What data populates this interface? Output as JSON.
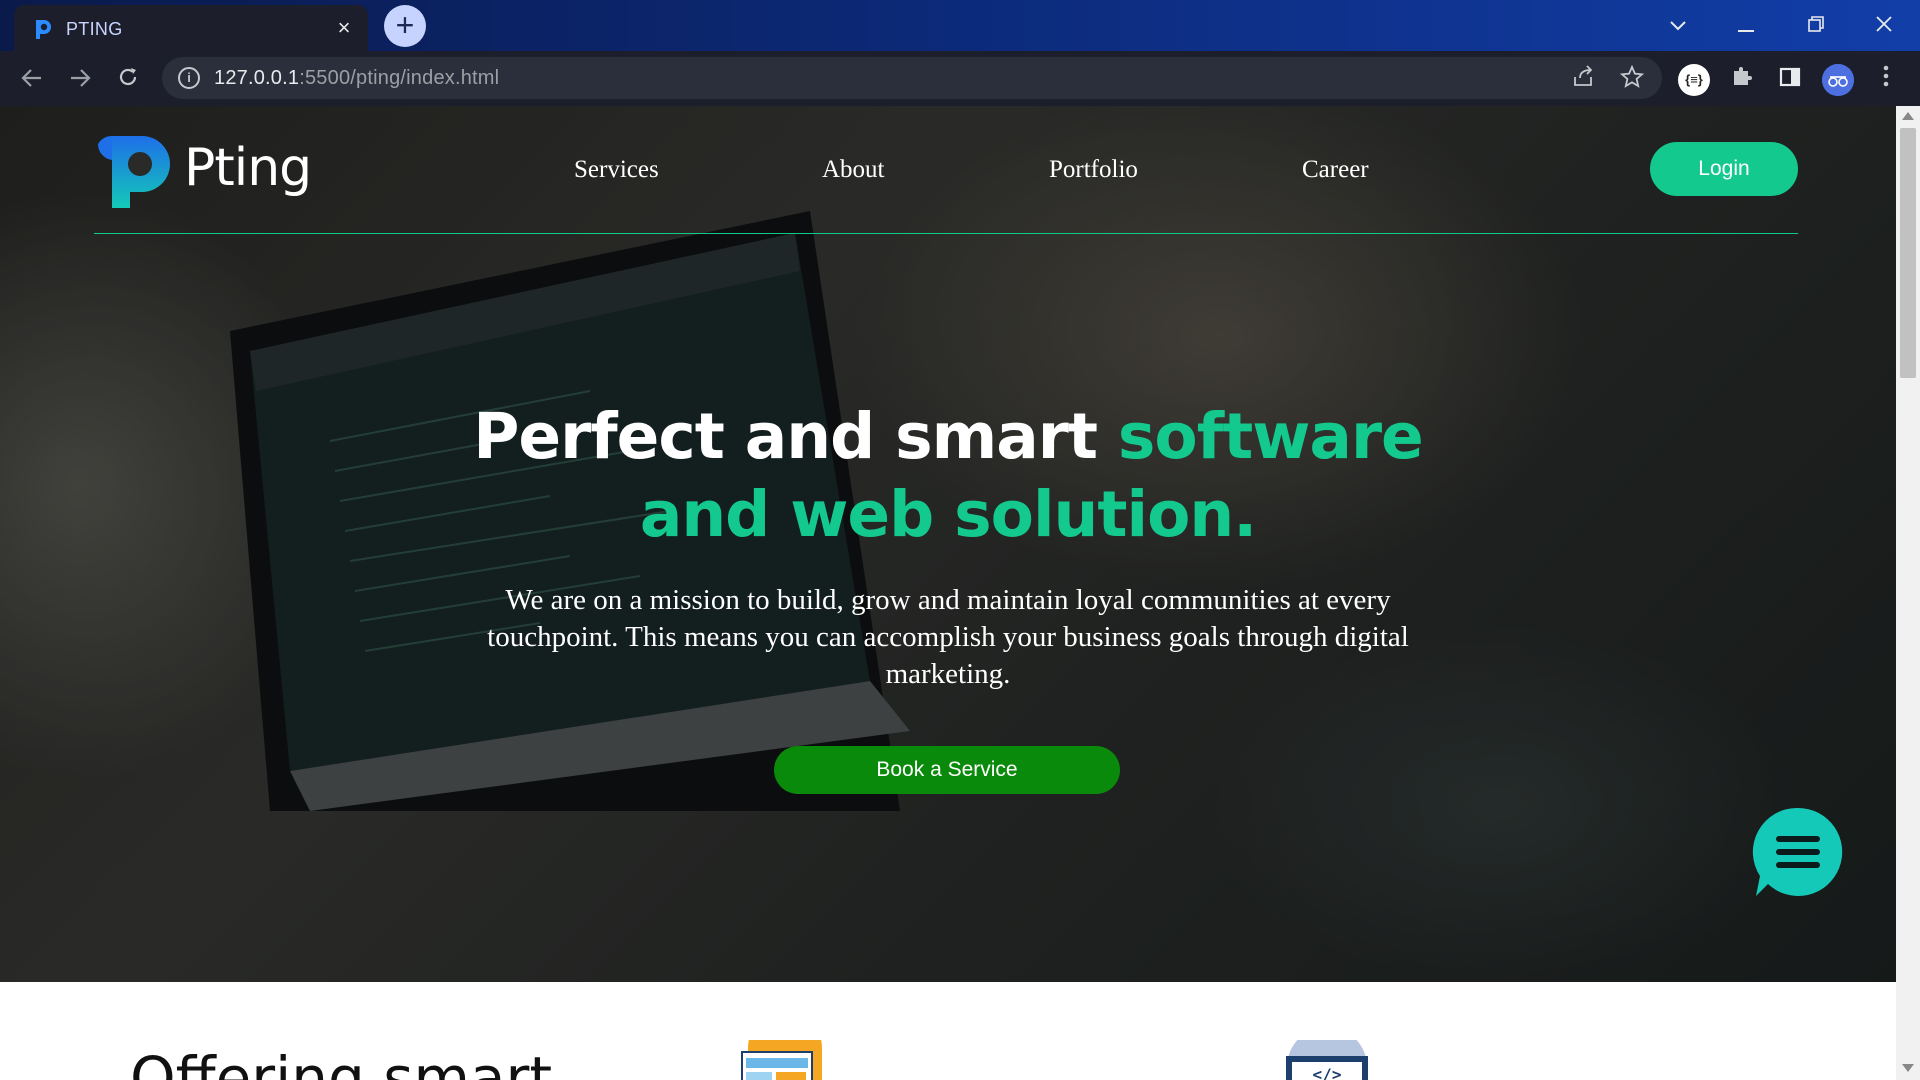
{
  "browser": {
    "tab_title": "PTING",
    "tab_close": "×",
    "new_tab": "+",
    "url_host": "127.0.0.1",
    "url_rest": ":5500/pting/index.html",
    "ext_badge": "{≡}",
    "icons": [
      "back-icon",
      "forward-icon",
      "reload-icon",
      "info-icon",
      "share-icon",
      "star-icon",
      "extension-icon",
      "puzzle-icon",
      "sidepanel-icon",
      "profile-icon",
      "menu-dots-icon"
    ]
  },
  "site": {
    "logo_text": "Pting",
    "nav": [
      {
        "label": "Services"
      },
      {
        "label": "About"
      },
      {
        "label": "Portfolio"
      },
      {
        "label": "Career"
      }
    ],
    "login_label": "Login",
    "hero": {
      "title_white": "Perfect and smart ",
      "title_accent": "software and web solution.",
      "subtitle": "We are on a mission to build, grow and maintain loyal communities at every touchpoint. This means you can accomplish your business goals through digital marketing.",
      "cta_label": "Book a Service"
    },
    "section2": {
      "title": "Offering smart"
    },
    "colors": {
      "accent": "#14c98e",
      "cta": "#0a8a0a",
      "logo_blue": "#1e6fe8"
    }
  }
}
